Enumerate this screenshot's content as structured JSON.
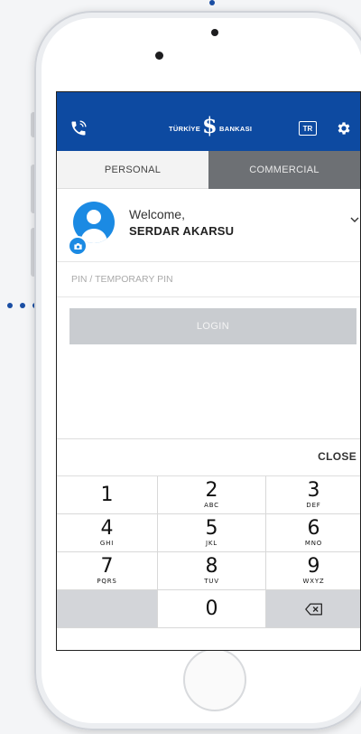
{
  "header": {
    "brand_text_left": "TÜRKİYE",
    "brand_mark": "$",
    "brand_text_right": "BANKASI",
    "language": "TR"
  },
  "tabs": [
    {
      "label": "PERSONAL",
      "active": true
    },
    {
      "label": "COMMERCIAL",
      "active": false
    }
  ],
  "user": {
    "greeting": "Welcome,",
    "name": "SERDAR AKARSU"
  },
  "pin": {
    "placeholder": "PIN / TEMPORARY PIN",
    "value": ""
  },
  "login_label": "LOGIN",
  "keypad": {
    "close_label": "CLOSE",
    "keys": [
      {
        "num": "1",
        "letters": ""
      },
      {
        "num": "2",
        "letters": "ABC"
      },
      {
        "num": "3",
        "letters": "DEF"
      },
      {
        "num": "4",
        "letters": "GHI"
      },
      {
        "num": "5",
        "letters": "JKL"
      },
      {
        "num": "6",
        "letters": "MNO"
      },
      {
        "num": "7",
        "letters": "PQRS"
      },
      {
        "num": "8",
        "letters": "TUV"
      },
      {
        "num": "9",
        "letters": "WXYZ"
      },
      {
        "num": "0",
        "letters": ""
      }
    ]
  },
  "icons": {
    "top_left": "phone-call-icon",
    "settings": "gear-icon",
    "expand": "chevron-down-icon",
    "avatar_badge": "camera-icon",
    "delete": "backspace-icon"
  },
  "colors": {
    "brand_blue": "#0d4aa1",
    "avatar_blue": "#1b8ae3",
    "inactive_tab": "#6d7074",
    "login_disabled": "#c9ccd0"
  }
}
